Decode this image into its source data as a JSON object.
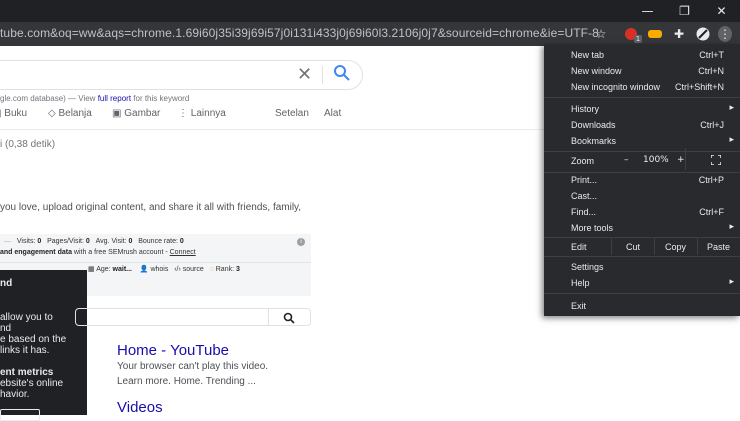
{
  "browser": {
    "url": "tube.com&oq=ww&aqs=chrome.1.69i60j35i39j69i57j0i131i433j0j69i60l3.2106j0j7&sourceid=chrome&ie=UTF-8",
    "window": {
      "minimize": "—",
      "restore": "❐",
      "close": "✕"
    },
    "toolbar_icons": [
      "star-icon",
      "extension-badge-icon",
      "extension-icon",
      "puzzle-icon",
      "profile-icon",
      "kebab-menu-icon"
    ],
    "badge_count": "1"
  },
  "search": {
    "db_prefix": "gle.com database) — View ",
    "db_link": "full report",
    "db_suffix": " for this keyword",
    "tabs": [
      {
        "label": "Buku",
        "icon": "book-icon"
      },
      {
        "label": "Belanja",
        "icon": "tag-icon"
      },
      {
        "label": "Gambar",
        "icon": "image-icon"
      },
      {
        "label": "Lainnya",
        "icon": "more-dots-icon"
      },
      {
        "label": "Setelan"
      },
      {
        "label": "Alat"
      }
    ],
    "result_stats": "i (0,38 detik)",
    "snippet": "you love, upload original content, and share it all with friends, family,"
  },
  "semrush": {
    "visits_label": "Visits:",
    "visits": "0",
    "pages_label": "Pages/Visit:",
    "pages": "0",
    "avg_label": "Avg. Visit:",
    "avg": "0",
    "bounce_label": "Bounce rate:",
    "bounce": "0",
    "row2_bold": "and engagement data",
    "row2_text": " with a free SEMrush account - ",
    "row2_link": "Connect",
    "age_label": "Age:",
    "age": "wait...",
    "whois": "whois",
    "source": "source",
    "rank_label": "Rank:",
    "rank": "3"
  },
  "overlay": {
    "lines": [
      "nd",
      "allow you to",
      "nd",
      "e based on the",
      "links it has.",
      "ent metrics",
      "ebsite's online",
      "havior."
    ]
  },
  "results": [
    {
      "title": "Home - YouTube",
      "desc1": "Your browser can't play this video.",
      "desc2": "Learn more. Home. Trending ..."
    },
    {
      "title": "Videos"
    }
  ],
  "menu": {
    "new_tab": "New tab",
    "new_tab_sc": "Ctrl+T",
    "new_window": "New window",
    "new_window_sc": "Ctrl+N",
    "incognito": "New incognito window",
    "incognito_sc": "Ctrl+Shift+N",
    "history": "History",
    "downloads": "Downloads",
    "downloads_sc": "Ctrl+J",
    "bookmarks": "Bookmarks",
    "zoom": "Zoom",
    "zoom_minus": "–",
    "zoom_value": "100%",
    "zoom_plus": "+",
    "print": "Print...",
    "print_sc": "Ctrl+P",
    "cast": "Cast...",
    "find": "Find...",
    "find_sc": "Ctrl+F",
    "more_tools": "More tools",
    "edit": "Edit",
    "cut": "Cut",
    "copy": "Copy",
    "paste": "Paste",
    "settings": "Settings",
    "help": "Help",
    "exit": "Exit"
  }
}
